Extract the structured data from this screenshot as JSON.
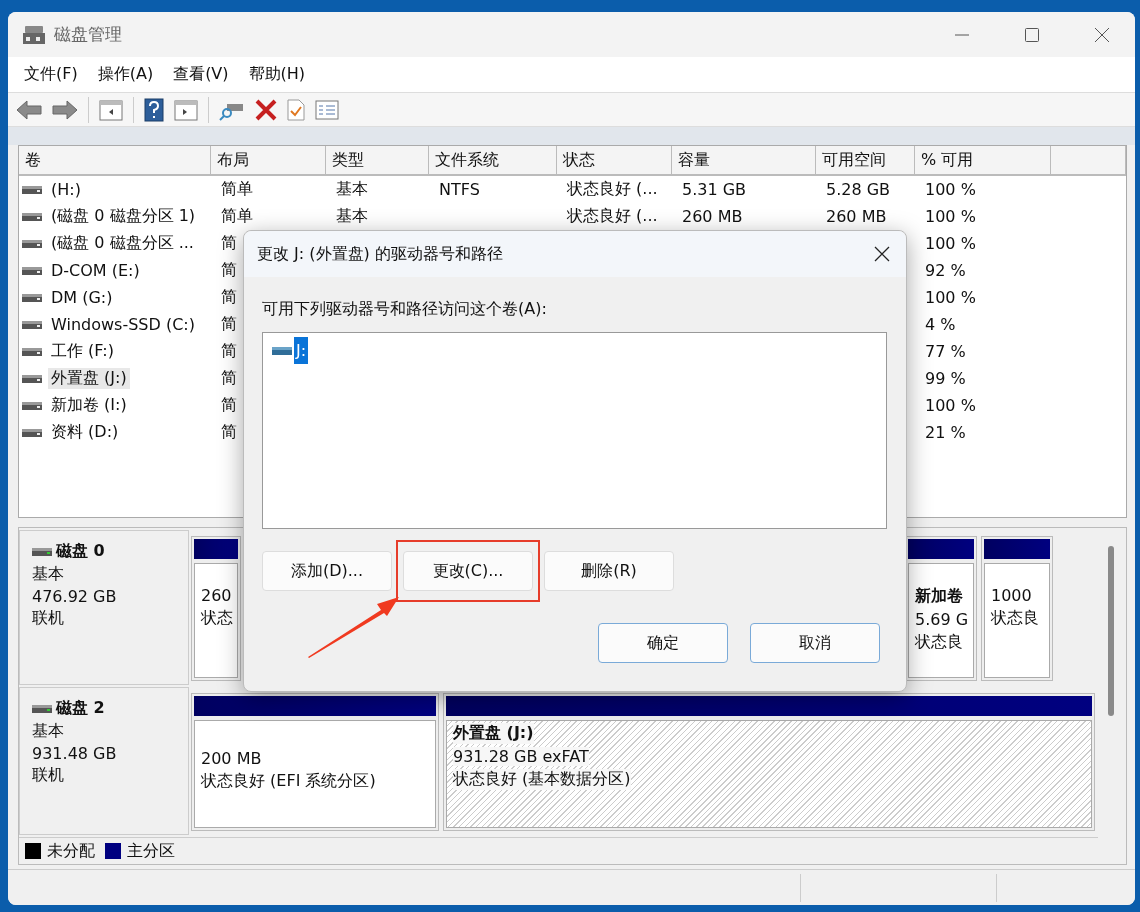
{
  "window": {
    "title": "磁盘管理"
  },
  "menu": [
    "文件(F)",
    "操作(A)",
    "查看(V)",
    "帮助(H)"
  ],
  "volumes": {
    "columns": [
      "卷",
      "布局",
      "类型",
      "文件系统",
      "状态",
      "容量",
      "可用空间",
      "% 可用"
    ],
    "rows": [
      {
        "name": "(H:)",
        "layout": "简单",
        "type": "基本",
        "file_system": "NTFS",
        "status": "状态良好 (...",
        "capacity": "5.31 GB",
        "free": "5.28 GB",
        "percent": "100 %",
        "selected": false
      },
      {
        "name": "(磁盘 0 磁盘分区 1)",
        "layout": "简单",
        "type": "基本",
        "status": "状态良好 (...",
        "capacity": "260 MB",
        "free": "260 MB",
        "percent": "100 %",
        "selected": false
      },
      {
        "name": "(磁盘 0 磁盘分区 ...",
        "layout": "简",
        "percent": "100 %",
        "selected": false
      },
      {
        "name": "D-COM (E:)",
        "layout": "简",
        "percent": "92 %",
        "selected": false
      },
      {
        "name": "DM (G:)",
        "layout": "简",
        "percent": "100 %",
        "selected": false
      },
      {
        "name": "Windows-SSD (C:)",
        "layout": "简",
        "percent": "4 %",
        "selected": false
      },
      {
        "name": "工作 (F:)",
        "layout": "简",
        "percent": "77 %",
        "selected": false
      },
      {
        "name": "外置盘 (J:)",
        "layout": "简",
        "percent": "99 %",
        "selected": true
      },
      {
        "name": "新加卷 (I:)",
        "layout": "简",
        "percent": "100 %",
        "selected": false
      },
      {
        "name": "资料 (D:)",
        "layout": "简",
        "percent": "21 %",
        "selected": false
      }
    ]
  },
  "disks": [
    {
      "name": "磁盘 0",
      "type": "基本",
      "size": "476.92 GB",
      "status": "联机",
      "partitions": [
        {
          "size": "260",
          "status": "状态",
          "selected": false
        },
        {
          "name": "新加卷",
          "size": "5.69 G",
          "status": "状态良",
          "selected": false
        },
        {
          "size": "1000",
          "status": "状态良",
          "selected": false
        }
      ]
    },
    {
      "name": "磁盘 2",
      "type": "基本",
      "size": "931.48 GB",
      "status": "联机",
      "partitions": [
        {
          "size": "200 MB",
          "status": "状态良好 (EFI 系统分区)",
          "selected": false
        },
        {
          "name": "外置盘 (J:)",
          "size": "931.28 GB exFAT",
          "status": "状态良好 (基本数据分区)",
          "selected": true
        }
      ]
    }
  ],
  "legend": [
    {
      "label": "未分配",
      "color": "#000000"
    },
    {
      "label": "主分区",
      "color": "#000080"
    }
  ],
  "dialog": {
    "title": "更改 J: (外置盘) 的驱动器号和路径",
    "prompt": "可用下列驱动器号和路径访问这个卷(A):",
    "paths": [
      {
        "label": "J:",
        "selected": true
      }
    ],
    "buttons": [
      {
        "label": "添加(D)...",
        "highlighted": false
      },
      {
        "label": "更改(C)...",
        "highlighted": true
      },
      {
        "label": "删除(R)",
        "highlighted": false
      }
    ],
    "footer_buttons": [
      "确定",
      "取消"
    ]
  }
}
